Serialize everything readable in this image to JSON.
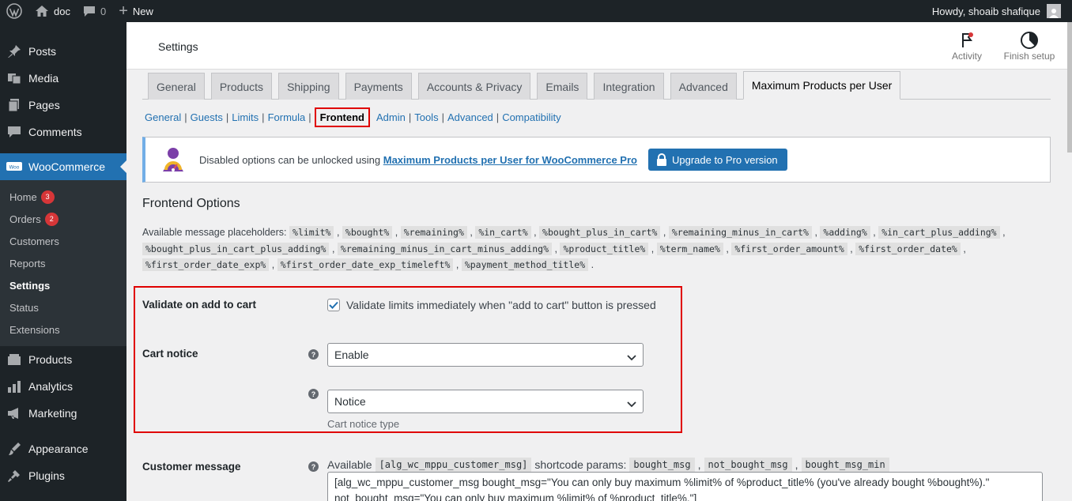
{
  "adminbar": {
    "site_name": "doc",
    "comments_count": "0",
    "new_label": "New",
    "howdy": "Howdy, shoaib shafique"
  },
  "sidebar": {
    "items": [
      {
        "label": "Posts",
        "icon": "pin-icon"
      },
      {
        "label": "Media",
        "icon": "media-icon"
      },
      {
        "label": "Pages",
        "icon": "pages-icon"
      },
      {
        "label": "Comments",
        "icon": "comments-icon"
      }
    ],
    "woocommerce": "WooCommerce",
    "woo_sub": [
      {
        "label": "Home",
        "badge": "3"
      },
      {
        "label": "Orders",
        "badge": "2"
      },
      {
        "label": "Customers"
      },
      {
        "label": "Reports"
      },
      {
        "label": "Settings"
      },
      {
        "label": "Status"
      },
      {
        "label": "Extensions"
      }
    ],
    "items2": [
      {
        "label": "Products",
        "icon": "products-icon"
      },
      {
        "label": "Analytics",
        "icon": "analytics-icon"
      },
      {
        "label": "Marketing",
        "icon": "marketing-icon"
      },
      {
        "label": "Appearance",
        "icon": "appearance-icon"
      },
      {
        "label": "Plugins",
        "icon": "plugins-icon"
      }
    ]
  },
  "header": {
    "title": "Settings",
    "activity": "Activity",
    "finish_setup": "Finish setup"
  },
  "tabs": [
    "General",
    "Products",
    "Shipping",
    "Payments",
    "Accounts & Privacy",
    "Emails",
    "Integration",
    "Advanced",
    "Maximum Products per User"
  ],
  "subsections": [
    "General",
    "Guests",
    "Limits",
    "Formula",
    "Frontend",
    "Admin",
    "Tools",
    "Advanced",
    "Compatibility"
  ],
  "notice": {
    "text": "Disabled options can be unlocked using",
    "link": "Maximum Products per User for WooCommerce Pro",
    "button": "Upgrade to Pro version"
  },
  "section_title": "Frontend Options",
  "placeholders": {
    "intro": "Available message placeholders:",
    "codes": [
      "%limit%",
      "%bought%",
      "%remaining%",
      "%in_cart%",
      "%bought_plus_in_cart%",
      "%remaining_minus_in_cart%",
      "%adding%",
      "%in_cart_plus_adding%",
      "%bought_plus_in_cart_plus_adding%",
      "%remaining_minus_in_cart_minus_adding%",
      "%product_title%",
      "%term_name%",
      "%first_order_amount%",
      "%first_order_date%",
      "%first_order_date_exp%",
      "%first_order_date_exp_timeleft%",
      "%payment_method_title%"
    ]
  },
  "fields": {
    "validate_label": "Validate on add to cart",
    "validate_text": "Validate limits immediately when \"add to cart\" button is pressed",
    "cart_notice_label": "Cart notice",
    "cart_notice_value": "Enable",
    "notice_type_value": "Notice",
    "notice_type_desc": "Cart notice type",
    "customer_message_label": "Customer message",
    "available": "Available",
    "shortcode": "[alg_wc_mppu_customer_msg]",
    "shortcode_params": "shortcode params:",
    "params": [
      "bought_msg",
      "not_bought_msg",
      "bought_msg_min"
    ],
    "textarea": "[alg_wc_mppu_customer_msg bought_msg=\"You can only buy maximum %limit% of %product_title% (you've already bought %bought%).\" not_bought_msg=\"You can only buy maximum %limit% of %product_title%.\"]"
  },
  "colors": {
    "accent": "#2271b1",
    "highlight_red": "#e00000",
    "sidebar_bg": "#1d2327"
  }
}
